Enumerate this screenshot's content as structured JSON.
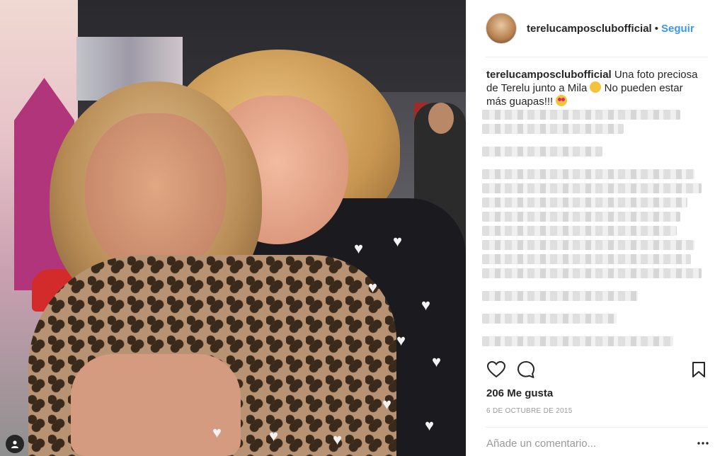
{
  "header": {
    "username": "terelucamposclubofficial",
    "separator": "•",
    "follow_label": "Seguir"
  },
  "caption": {
    "username": "terelucamposclubofficial",
    "text_part1": "Una foto preciosa de Terelu junto a Mila",
    "text_part2": "No pueden estar más guapas!!!"
  },
  "post": {
    "likes": "206 Me gusta",
    "date": "6 DE OCTUBRE DE 2015"
  },
  "comment_box": {
    "placeholder": "Añade un comentario..."
  },
  "icons": {
    "like": "heart-outline-icon",
    "comment": "comment-bubble-icon",
    "save": "bookmark-icon",
    "more": "more-dots-icon",
    "user_tag": "user-tag-icon"
  },
  "colors": {
    "link": "#3897f0",
    "text": "#262626",
    "muted": "#999999",
    "divider": "#efefef"
  }
}
